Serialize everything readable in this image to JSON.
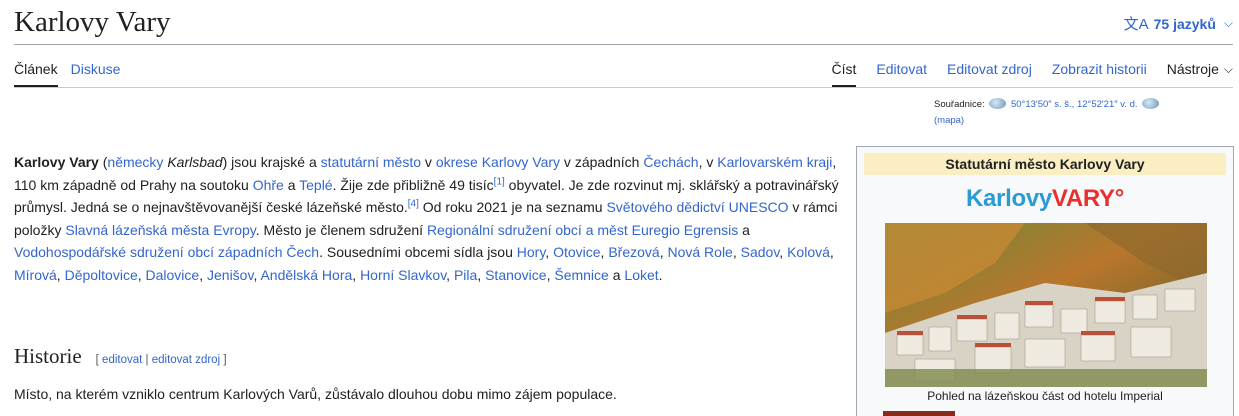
{
  "header": {
    "title": "Karlovy Vary",
    "lang_label": "75 jazyků",
    "lang_icon": "文A"
  },
  "tabs": {
    "article": "Článek",
    "talk": "Diskuse",
    "read": "Číst",
    "edit": "Editovat",
    "edit_source": "Editovat zdroj",
    "history": "Zobrazit historii",
    "tools": "Nástroje"
  },
  "coords": {
    "label": "Souřadnice:",
    "value": "50°13′50″ s. š., 12°52′21″ v. d.",
    "map": "(mapa)"
  },
  "article": {
    "p1": [
      {
        "t": "Karlovy Vary",
        "b": true
      },
      {
        "t": " ("
      },
      {
        "t": "německy",
        "link": true
      },
      {
        "t": " "
      },
      {
        "t": "Karlsbad",
        "i": true
      },
      {
        "t": ") jsou krajské a "
      },
      {
        "t": "statutární město",
        "link": true
      },
      {
        "t": " v "
      },
      {
        "t": "okrese Karlovy Vary",
        "link": true
      },
      {
        "t": " v západních "
      },
      {
        "t": "Čechách",
        "link": true
      },
      {
        "t": ", v "
      },
      {
        "t": "Karlovarském kraji",
        "link": true
      },
      {
        "t": ", 110 km západně od Prahy na soutoku "
      },
      {
        "t": "Ohře",
        "link": true
      },
      {
        "t": " a "
      },
      {
        "t": "Teplé",
        "link": true
      },
      {
        "t": ". Žije zde přibližně 49 tisíc"
      },
      {
        "t": "[1]",
        "sup": true
      },
      {
        "t": " obyvatel. Je zde rozvinut mj. sklářský a potravinářský průmysl. Jedná se o nejnavštěvovanější české lázeňské město."
      },
      {
        "t": "[4]",
        "sup": true
      },
      {
        "t": " Od roku 2021 je na seznamu "
      },
      {
        "t": "Světového dědictví UNESCO",
        "link": true
      },
      {
        "t": " v rámci položky "
      },
      {
        "t": "Slavná lázeňská města Evropy",
        "link": true
      },
      {
        "t": ". Město je členem sdružení "
      },
      {
        "t": "Regionální sdružení obcí a měst Euregio Egrensis",
        "link": true
      },
      {
        "t": " a "
      },
      {
        "t": "Vodohospodářské sdružení obcí západních Čech",
        "link": true
      },
      {
        "t": ". Sousedními obcemi sídla jsou "
      },
      {
        "t": "Hory",
        "link": true
      },
      {
        "t": ", "
      },
      {
        "t": "Otovice",
        "link": true
      },
      {
        "t": ", "
      },
      {
        "t": "Březová",
        "link": true
      },
      {
        "t": ", "
      },
      {
        "t": "Nová Role",
        "link": true
      },
      {
        "t": ", "
      },
      {
        "t": "Sadov",
        "link": true
      },
      {
        "t": ", "
      },
      {
        "t": "Kolová",
        "link": true
      },
      {
        "t": ", "
      },
      {
        "t": "Mírová",
        "link": true
      },
      {
        "t": ", "
      },
      {
        "t": "Děpoltovice",
        "link": true
      },
      {
        "t": ", "
      },
      {
        "t": "Dalovice",
        "link": true
      },
      {
        "t": ", "
      },
      {
        "t": "Jenišov",
        "link": true
      },
      {
        "t": ", "
      },
      {
        "t": "Andělská Hora",
        "link": true
      },
      {
        "t": ", "
      },
      {
        "t": "Horní Slavkov",
        "link": true
      },
      {
        "t": ", "
      },
      {
        "t": "Pila",
        "link": true
      },
      {
        "t": ", "
      },
      {
        "t": "Stanovice",
        "link": true
      },
      {
        "t": ", "
      },
      {
        "t": "Šemnice",
        "link": true
      },
      {
        "t": " a "
      },
      {
        "t": "Loket",
        "link": true
      },
      {
        "t": "."
      }
    ]
  },
  "history": {
    "heading": "Historie",
    "edit_bracket_open": "[ ",
    "edit": "editovat",
    "sep": " | ",
    "edit_source": "editovat zdroj",
    "edit_bracket_close": " ]",
    "text": "Místo, na kterém vzniklo centrum Karlových Varů, zůstávalo dlouhou dobu mimo zájem populace."
  },
  "infobox": {
    "title": "Statutární město Karlovy Vary",
    "logo_part1": "Karlovy",
    "logo_part2": "VARY°",
    "caption": "Pohled na lázeňskou část od hotelu Imperial"
  },
  "colors": {
    "link": "#3366cc",
    "infobox_header": "#fbeec3",
    "logo_blue": "#2b9bd6",
    "logo_red": "#e8312f"
  }
}
